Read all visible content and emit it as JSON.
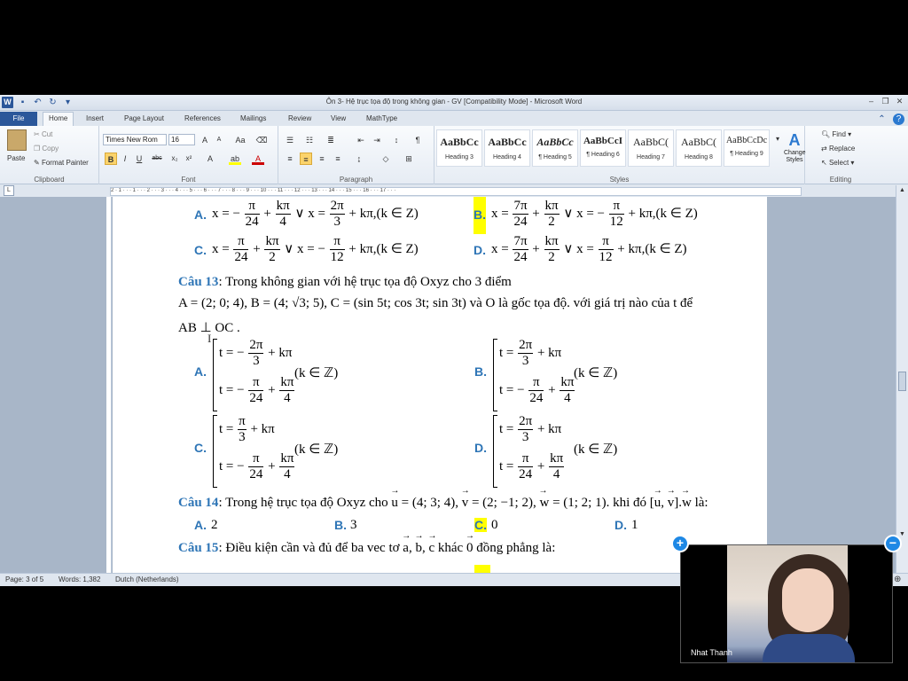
{
  "window": {
    "title": "Ôn 3- Hệ trục tọa độ trong không gian - GV [Compatibility Mode] - Microsoft Word"
  },
  "tabs": [
    "File",
    "Home",
    "Insert",
    "Page Layout",
    "References",
    "Mailings",
    "Review",
    "View",
    "MathType"
  ],
  "clipboard": {
    "paste": "Paste",
    "cut": "Cut",
    "copy": "Copy",
    "format_painter": "Format Painter",
    "label": "Clipboard"
  },
  "font": {
    "name": "Times New Rom",
    "size": "16",
    "label": "Font"
  },
  "paragraph": {
    "label": "Paragraph"
  },
  "styles": {
    "items": [
      {
        "sample": "AaBbCc",
        "name": "Heading 3"
      },
      {
        "sample": "AaBbCc",
        "name": "Heading 4"
      },
      {
        "sample": "AaBbCc",
        "name": "¶ Heading 5"
      },
      {
        "sample": "AaBbCcI",
        "name": "¶ Heading 6"
      },
      {
        "sample": "AaBbC(",
        "name": "Heading 7"
      },
      {
        "sample": "AaBbC(",
        "name": "Heading 8"
      },
      {
        "sample": "AaBbCcDc",
        "name": "¶ Heading 9"
      }
    ],
    "change_styles": "Change Styles",
    "label": "Styles"
  },
  "editing": {
    "find": "Find",
    "replace": "Replace",
    "select": "Select",
    "label": "Editing"
  },
  "status": {
    "page": "Page: 3 of 5",
    "words": "Words: 1,382",
    "language": "Dutch (Netherlands)"
  },
  "ruler": "2 · 1 · · · 1 · · · 2 · · · 3 · · · 4 · · · 5 · · · 6 · · · 7 · · · 8 · · · 9 · · · 10 · · · 11 · · · 12 · · · 13 · · · 14 · · · 15 · · · 16 · · · 17 · · ·",
  "doc": {
    "q12_options": {
      "a": "A.",
      "b": "B.",
      "c": "C.",
      "d": "D."
    },
    "q13": {
      "label": "Câu 13",
      "text": ": Trong không gian với hệ trục tọa độ Oxyz  cho 3 điểm",
      "line2_tail": " và O là gốc tọa độ. với giá trị nào của t để",
      "line3": "AB ⊥ OC ."
    },
    "q14": {
      "label": "Câu 14",
      "text": ": Trong hệ trục tọa độ Oxyz cho",
      "options": [
        {
          "letter": "A.",
          "value": "2"
        },
        {
          "letter": "B.",
          "value": "3"
        },
        {
          "letter": "C.",
          "value": "0"
        },
        {
          "letter": "D.",
          "value": "1"
        }
      ]
    },
    "q15": {
      "label": "Câu 15",
      "text": ": Điều kiện cần và đủ để ba vec tơ",
      "tail": "đồng phẳng là:"
    }
  },
  "video": {
    "name": "Nhat Thanh"
  }
}
